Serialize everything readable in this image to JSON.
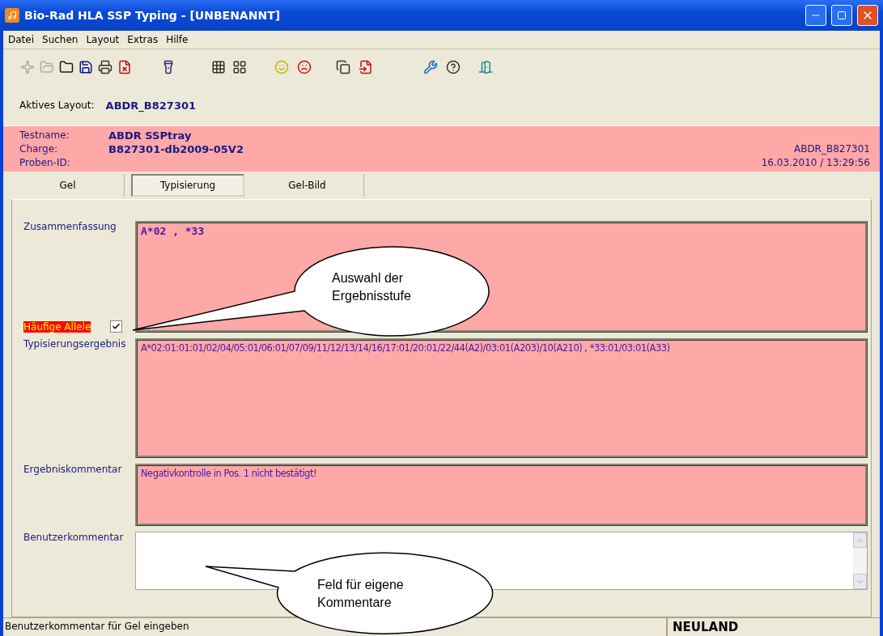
{
  "window": {
    "title": "Bio-Rad HLA SSP Typing - [UNBENANNT]"
  },
  "menu": [
    "Datei",
    "Suchen",
    "Layout",
    "Extras",
    "Hilfe"
  ],
  "toolbar": [
    {
      "disabled": true
    },
    {
      "disabled": true
    },
    {
      "disabled": false
    },
    {
      "disabled": false
    },
    {
      "disabled": false
    },
    {
      "disabled": false
    },
    {
      "disabled": false
    },
    {
      "disabled": false
    },
    {
      "disabled": false
    },
    {
      "disabled": false
    },
    {
      "disabled": false
    },
    {
      "disabled": false
    },
    {
      "disabled": false
    },
    {
      "disabled": false
    },
    {
      "disabled": false
    },
    {
      "disabled": false
    }
  ],
  "active_layout": {
    "label": "Aktives Layout:",
    "value": "ABDR_B827301"
  },
  "header": {
    "rows": [
      {
        "label": "Testname:",
        "value": "ABDR SSPtray"
      },
      {
        "label": "Charge:",
        "value": "B827301-db2009-05V2",
        "right": "ABDR_B827301"
      },
      {
        "label": "Proben-ID:",
        "right": "16.03.2010 / 13:29:56"
      }
    ]
  },
  "tabs": [
    {
      "label": "Gel",
      "selected": false
    },
    {
      "label": "Typisierung",
      "selected": true
    },
    {
      "label": "Gel-Bild",
      "selected": false
    }
  ],
  "fields": [
    {
      "kind": "summary",
      "label": "Zusammenfassung",
      "value": "A*02 , *33",
      "checkbox": {
        "label": "Häufige Allele",
        "checked": true
      }
    },
    {
      "kind": "result",
      "label": "Typisierungsergebnis",
      "value": "A*02:01:01:01/02/04/05:01/06:01/07/09/11/12/13/14/16/17:01/20:01/22/44(A2)/03:01(A203)/10(A210) , *33:01/03:01(A33)"
    },
    {
      "kind": "comment",
      "label": "Ergebniskommentar",
      "value": "Negativkontrolle in Pos. 1 nicht bestätigt!"
    },
    {
      "kind": "input",
      "label": "Benutzerkommentar"
    }
  ],
  "callouts": [
    "Auswahl der Ergebnisstufe",
    "Feld für eigene Kommentare"
  ],
  "status_bar": [
    "Benutzerkommentar für Gel eingeben",
    "NEULAND"
  ]
}
